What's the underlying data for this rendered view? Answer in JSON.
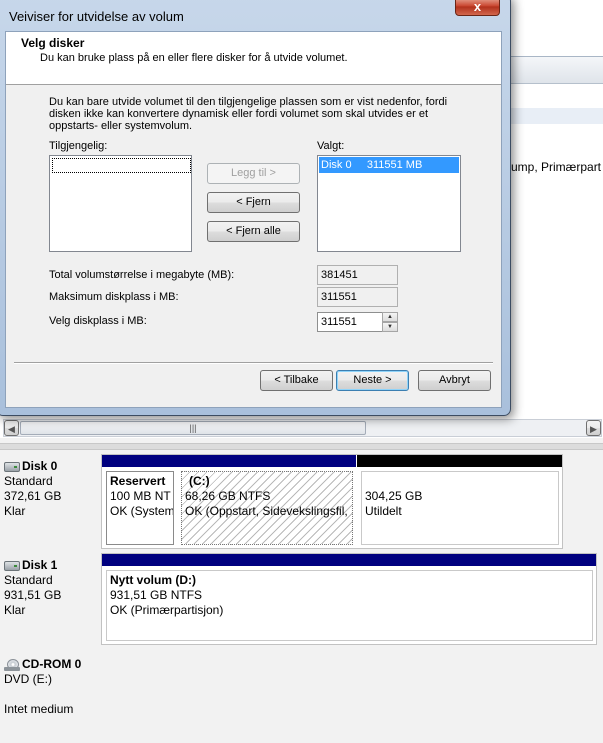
{
  "background": {
    "partial_row_text": "ump, Primærpart",
    "scroll_grip": "|||",
    "disks": [
      {
        "name": "Disk 0",
        "type": "Standard",
        "size": "372,61 GB",
        "status": "Klar",
        "partitions": [
          {
            "name": "Reservert",
            "size": "100 MB NT",
            "status": "OK (System",
            "color": "#00007f"
          },
          {
            "name": "(C:)",
            "size": "68,26 GB NTFS",
            "status": "OK (Oppstart, Sidevekslingsfil, K",
            "color": "#00007f"
          },
          {
            "name": "",
            "size": "304,25 GB",
            "status": "Utildelt",
            "color": "#000000"
          }
        ]
      },
      {
        "name": "Disk 1",
        "type": "Standard",
        "size": "931,51 GB",
        "status": "Klar",
        "partitions": [
          {
            "name": "Nytt volum  (D:)",
            "size": "931,51 GB NTFS",
            "status": "OK (Primærpartisjon)",
            "color": "#00007f"
          }
        ]
      },
      {
        "name": "CD-ROM 0",
        "type": "DVD (E:)",
        "status": "Intet medium"
      }
    ]
  },
  "dialog": {
    "title": "Veiviser for utvidelse av volum",
    "close_label": "x",
    "header_title": "Velg disker",
    "header_subtitle": "Du kan bruke plass på en eller flere disker for å utvide volumet.",
    "intro": "Du kan bare utvide volumet til den tilgjengelige plassen som er vist nedenfor, fordi disken ikke kan konvertere dynamisk eller fordi volumet som skal utvides er et oppstarts- eller systemvolum.",
    "available_label": "Tilgjengelig:",
    "selected_label": "Valgt:",
    "selected_items": [
      "Disk 0     311551 MB"
    ],
    "add_button": "Legg til >",
    "remove_button": "< Fjern",
    "remove_all_button": "< Fjern alle",
    "total_label": "Total volumstørrelse i megabyte (MB):",
    "total_value": "381451",
    "max_label": "Maksimum diskplass i MB:",
    "max_value": "311551",
    "select_label": "Velg diskplass i MB:",
    "select_value": "311551",
    "back_button": "< Tilbake",
    "next_button": "Neste >",
    "cancel_button": "Avbryt"
  }
}
